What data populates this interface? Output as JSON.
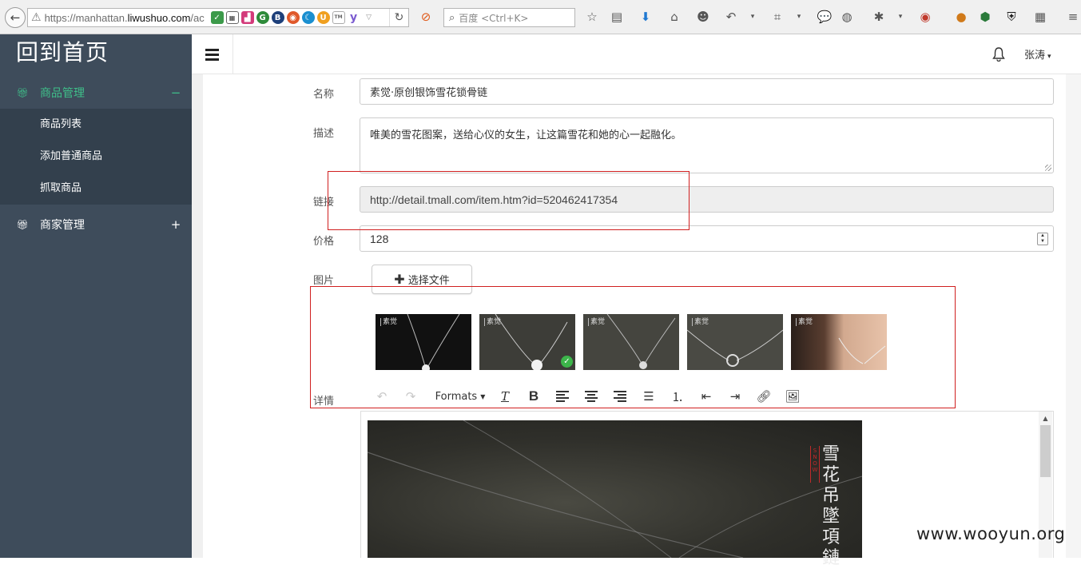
{
  "browser": {
    "url_prefix": "https://manhattan.",
    "url_domain": "liwushuo.com",
    "url_suffix": "/ac",
    "search_placeholder": "百度 <Ctrl+K>"
  },
  "sidebar": {
    "home_link": "回到首页",
    "groups": [
      {
        "label": "商品管理",
        "toggle": "−",
        "icon": "gift-icon",
        "active": true,
        "items": [
          {
            "label": "商品列表"
          },
          {
            "label": "添加普通商品"
          },
          {
            "label": "抓取商品"
          }
        ]
      },
      {
        "label": "商家管理",
        "toggle": "+",
        "icon": "gift-icon",
        "active": false,
        "items": []
      }
    ]
  },
  "header": {
    "user_name": "张涛",
    "caret": "▾"
  },
  "form": {
    "name_label": "名称",
    "name_value": "素觉·原创银饰雪花锁骨链",
    "desc_label": "描述",
    "desc_value": "唯美的雪花图案，送给心仪的女生，让这篇雪花和她的心一起融化。",
    "link_label": "链接",
    "link_value": "http://detail.tmall.com/item.htm?id=520462417354",
    "price_label": "价格",
    "price_value": "128",
    "image_label": "图片",
    "file_button_label": "选择文件",
    "detail_label": "详情",
    "images": [
      {
        "brand": "素觉",
        "selected": false
      },
      {
        "brand": "素觉",
        "selected": true
      },
      {
        "brand": "素觉",
        "selected": false
      },
      {
        "brand": "素觉",
        "selected": false
      },
      {
        "brand": "素觉",
        "selected": false
      }
    ]
  },
  "editor": {
    "formats_label": "Formats",
    "toolbar_icons": [
      "undo-icon",
      "redo-icon",
      "clear-format-icon",
      "bold-icon",
      "align-left-icon",
      "align-center-icon",
      "align-right-icon",
      "bullet-list-icon",
      "numbered-list-icon",
      "outdent-icon",
      "indent-icon",
      "link-icon",
      "image-icon"
    ],
    "image_title_vertical": "雪花吊墜項鏈",
    "image_subtitle_red": "SNOW"
  },
  "watermark": "www.wooyun.org",
  "colors": {
    "sidebar_bg": "#3e4c5b",
    "submenu_bg": "#33404d",
    "active_green": "#3fbf8a",
    "annotation_red": "#d01f1f"
  }
}
